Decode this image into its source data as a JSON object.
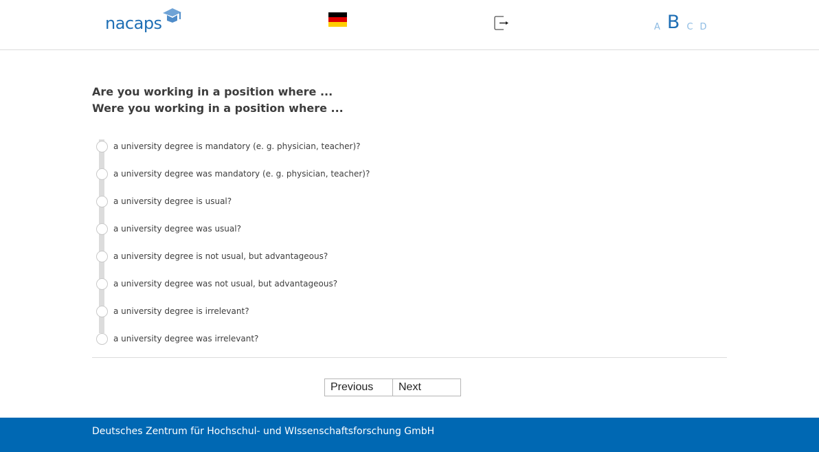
{
  "header": {
    "logo_text": "nacaps",
    "language_flag": "german-flag-icon",
    "logout_icon": "logout-icon",
    "font_sizes": {
      "a": "A",
      "b": "B",
      "c": "C",
      "d": "D"
    },
    "active_font_size": "B"
  },
  "question": {
    "line1": "Are you working in a position where ...",
    "line2": "Were you working in a position where ..."
  },
  "options": [
    {
      "label": "a university degree is mandatory (e. g. physician, teacher)?"
    },
    {
      "label": "a university degree was mandatory (e. g. physician, teacher)?"
    },
    {
      "label": "a university degree is usual?"
    },
    {
      "label": "a university degree was usual?"
    },
    {
      "label": "a university degree is not usual, but advantageous?"
    },
    {
      "label": "a university degree was not usual, but advantageous?"
    },
    {
      "label": "a university degree is irrelevant?"
    },
    {
      "label": "a university degree was irrelevant?"
    }
  ],
  "nav": {
    "previous": "Previous",
    "next": "Next"
  },
  "footer": {
    "text": "Deutsches Zentrum für Hochschul- und WIssenschaftsforschung GmbH"
  },
  "colors": {
    "brand_blue": "#0068b3",
    "logo_blue": "#1f6fb5",
    "font_size_inactive": "#8dbbe3",
    "text": "#3d3d3d"
  }
}
